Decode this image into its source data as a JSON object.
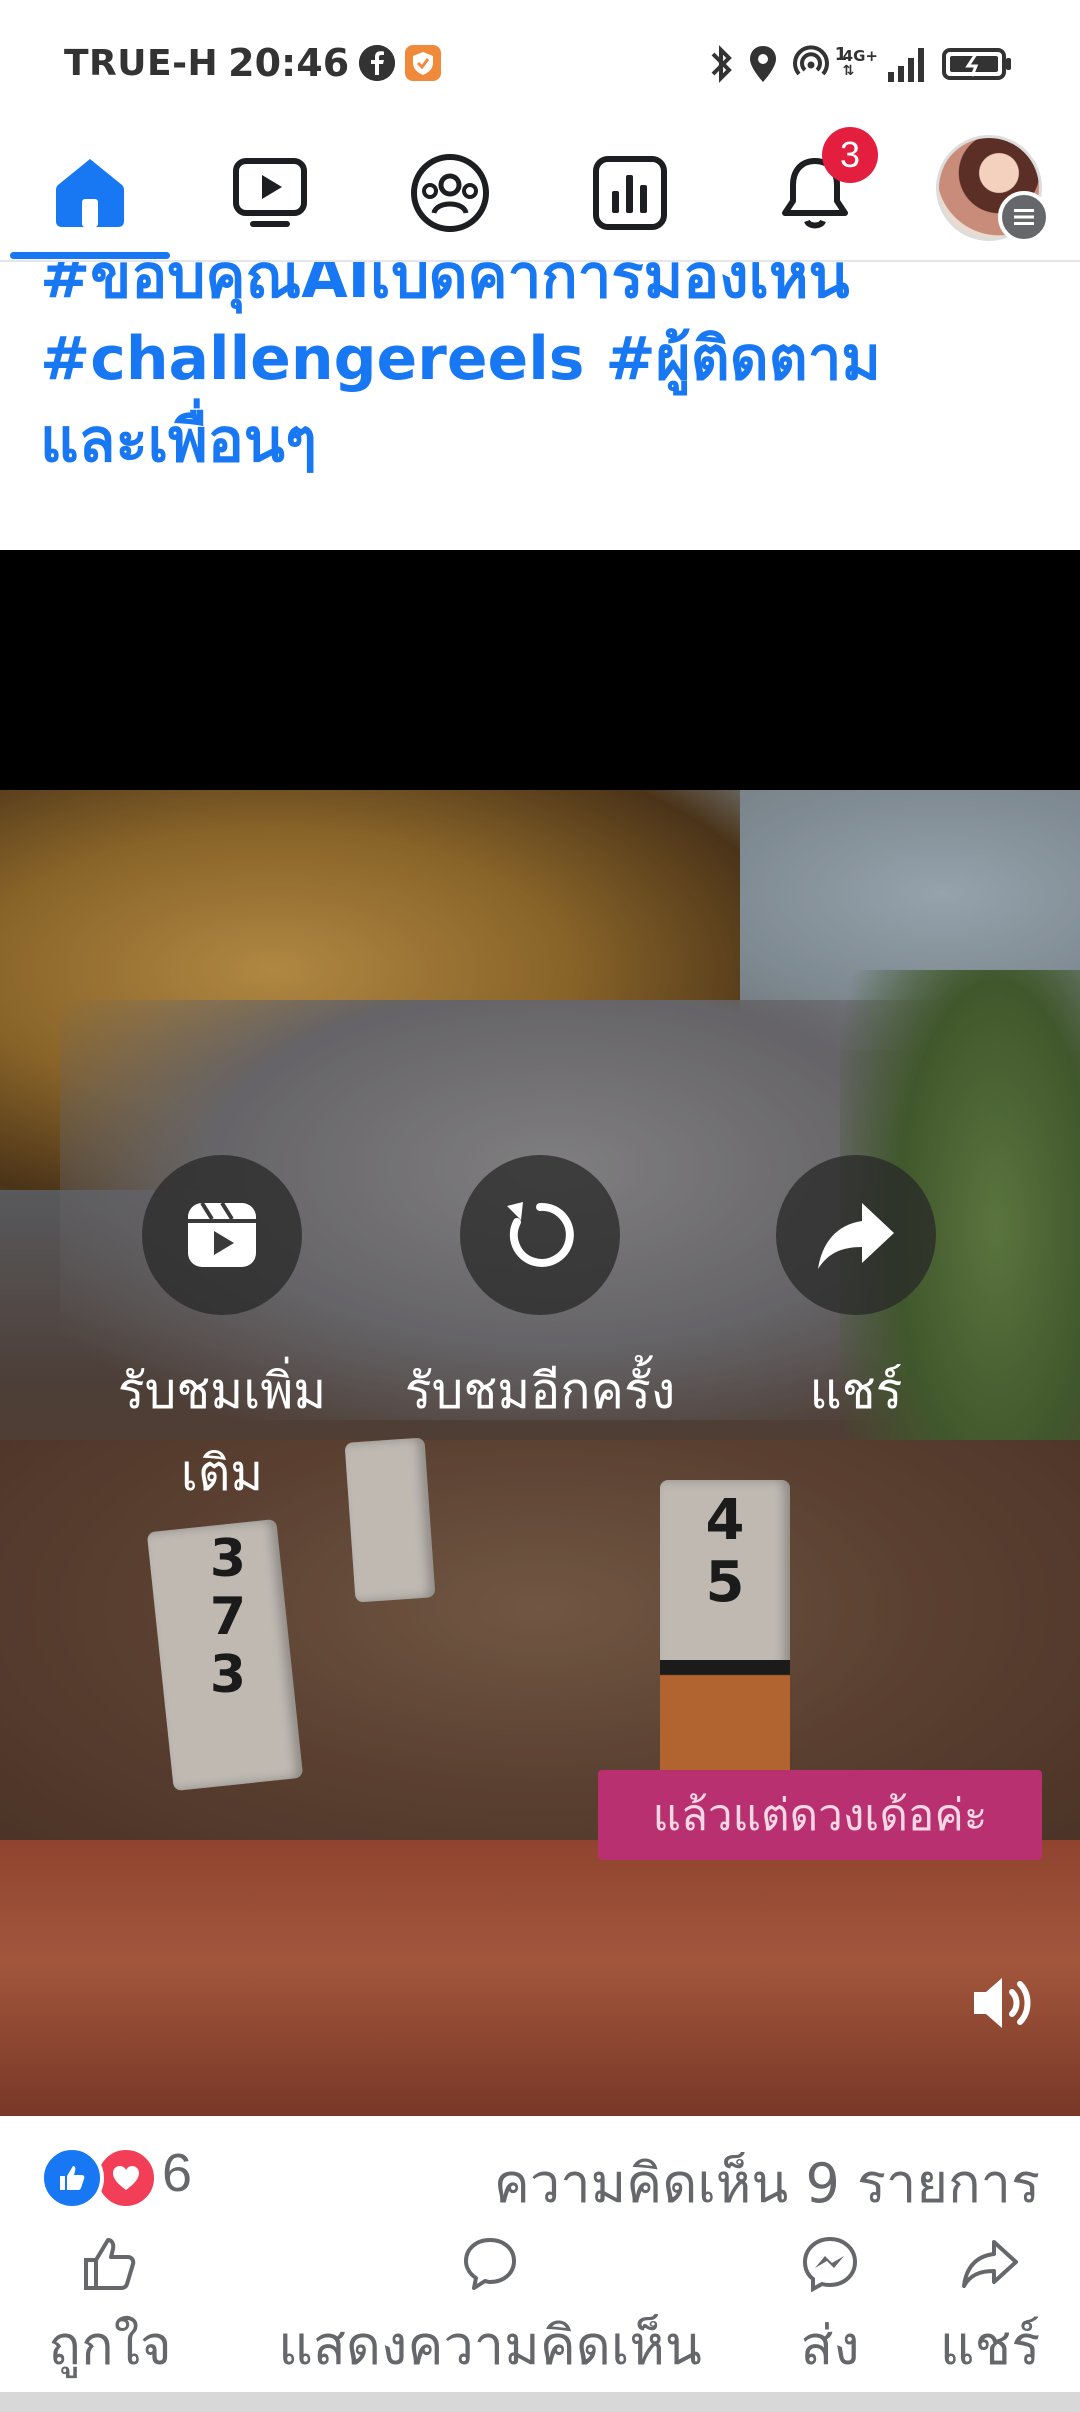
{
  "status_bar": {
    "carrier": "TRUE-H",
    "time": "20:46",
    "network": "4G+",
    "sim": "1"
  },
  "nav": {
    "notification_count": "3"
  },
  "post": {
    "caption_line1": "#ขอบคุณAIเปิดค่าการมองเห็น",
    "caption_line2": "#challengereels #ผู้ติดตาม",
    "caption_line3": "และเพื่อนๆ"
  },
  "video": {
    "controls": {
      "watch_more": "รับชมเพิ่ม\nเติม",
      "watch_again": "รับชมอีกครั้ง",
      "share": "แชร์"
    },
    "subtitle": "แล้วแต่ดวงเด้อค่ะ",
    "stick_left": "3\n7\n3",
    "stick_right": "4\n5"
  },
  "reactions": {
    "count": "6",
    "comments": "ความคิดเห็น 9 รายการ"
  },
  "actions": {
    "like": "ถูกใจ",
    "comment": "แสดงความคิดเห็น",
    "send": "ส่ง",
    "share": "แชร์"
  },
  "colors": {
    "accent": "#1877f2",
    "badge": "#e41e3f",
    "subtitle_bg": "#b8306f"
  }
}
